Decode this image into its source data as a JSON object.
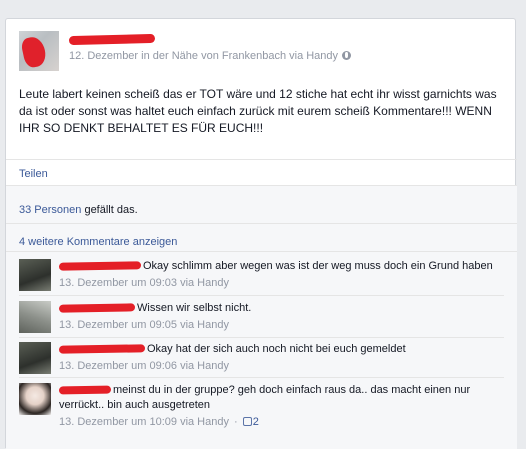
{
  "post": {
    "meta": "12. Dezember in der Nähe von Frankenbach via Handy",
    "text": "Leute labert keinen scheiß das er TOT wäre und 12 stiche hat echt ihr wisst garnichts was da ist oder sonst was haltet euch einfach zurück mit eurem scheiß Kommentare!!! WENN IHR SO DENKT BEHALTET ES FÜR EUCH!!!",
    "share_label": "Teilen",
    "likes_link": "33 Personen",
    "likes_text": " gefällt das.",
    "more_comments": "4 weitere Kommentare anzeigen",
    "globe_icon": "globe-icon"
  },
  "comments": [
    {
      "text": "Okay schlimm aber wegen was ist der weg muss doch ein Grund haben",
      "meta": "13. Dezember um 09:03 via Handy"
    },
    {
      "text": "Wissen wir selbst nicht.",
      "meta": "13. Dezember um 09:05 via Handy"
    },
    {
      "text": "Okay hat der sich auch noch nicht bei euch gemeldet",
      "meta": "13. Dezember um 09:06 via Handy"
    },
    {
      "text": "meinst du in der gruppe? geh doch einfach raus da.. das macht einen nur verrückt.. bin auch ausgetreten",
      "meta": "13. Dezember um 10:09 via Handy",
      "sep": "·",
      "like_count": "2"
    }
  ],
  "colors": {
    "link": "#3b5998",
    "meta": "#9197a3",
    "redaction": "#e41f27"
  }
}
